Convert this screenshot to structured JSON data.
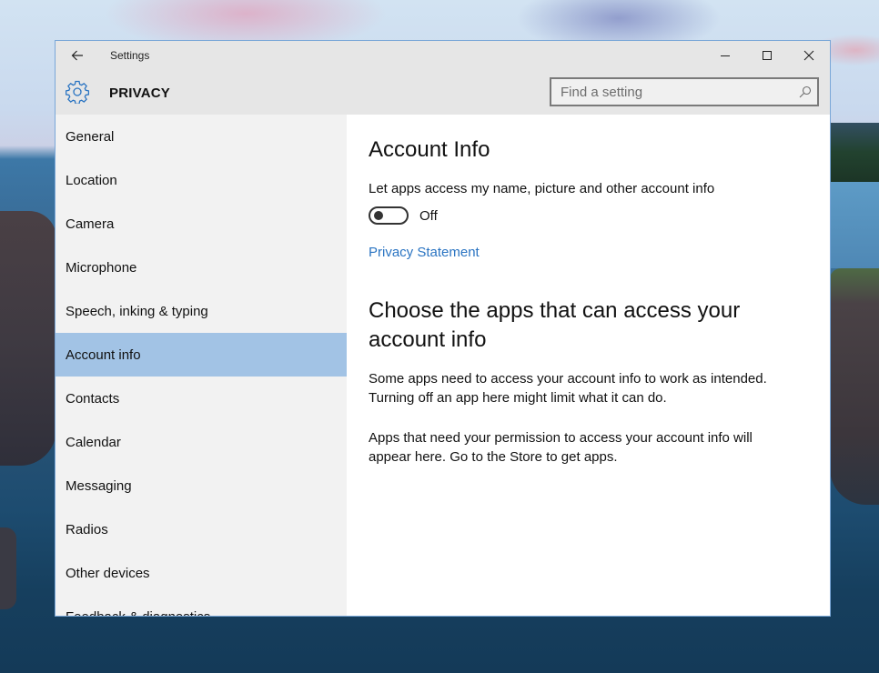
{
  "window": {
    "title": "Settings",
    "controls": {
      "back": "back-arrow-icon",
      "minimize": "minimize-icon",
      "maximize": "maximize-icon",
      "close": "close-icon"
    }
  },
  "header": {
    "icon": "gear-icon",
    "title": "PRIVACY",
    "search": {
      "placeholder": "Find a setting",
      "value": "",
      "icon": "search-icon"
    }
  },
  "sidebar": {
    "selected": "Account info",
    "items": [
      {
        "label": "General"
      },
      {
        "label": "Location"
      },
      {
        "label": "Camera"
      },
      {
        "label": "Microphone"
      },
      {
        "label": "Speech, inking & typing"
      },
      {
        "label": "Account info"
      },
      {
        "label": "Contacts"
      },
      {
        "label": "Calendar"
      },
      {
        "label": "Messaging"
      },
      {
        "label": "Radios"
      },
      {
        "label": "Other devices"
      },
      {
        "label": "Feedback & diagnostics"
      }
    ]
  },
  "content": {
    "title": "Account Info",
    "toggle": {
      "label": "Let apps access my name, picture and other account info",
      "state": "Off",
      "on": false
    },
    "privacy_link": "Privacy Statement",
    "section_title": "Choose the apps that can access your account info",
    "paragraph1": "Some apps need to access your account info to work as intended. Turning off an app here might limit what it can do.",
    "paragraph2": "Apps that need your permission to access your account info will appear here. Go to the Store to get apps."
  },
  "colors": {
    "accent": "#2a74c2",
    "selected_item": "#a2c3e5",
    "sidebar_bg": "#f2f2f2",
    "header_bg": "#e6e6e6"
  }
}
